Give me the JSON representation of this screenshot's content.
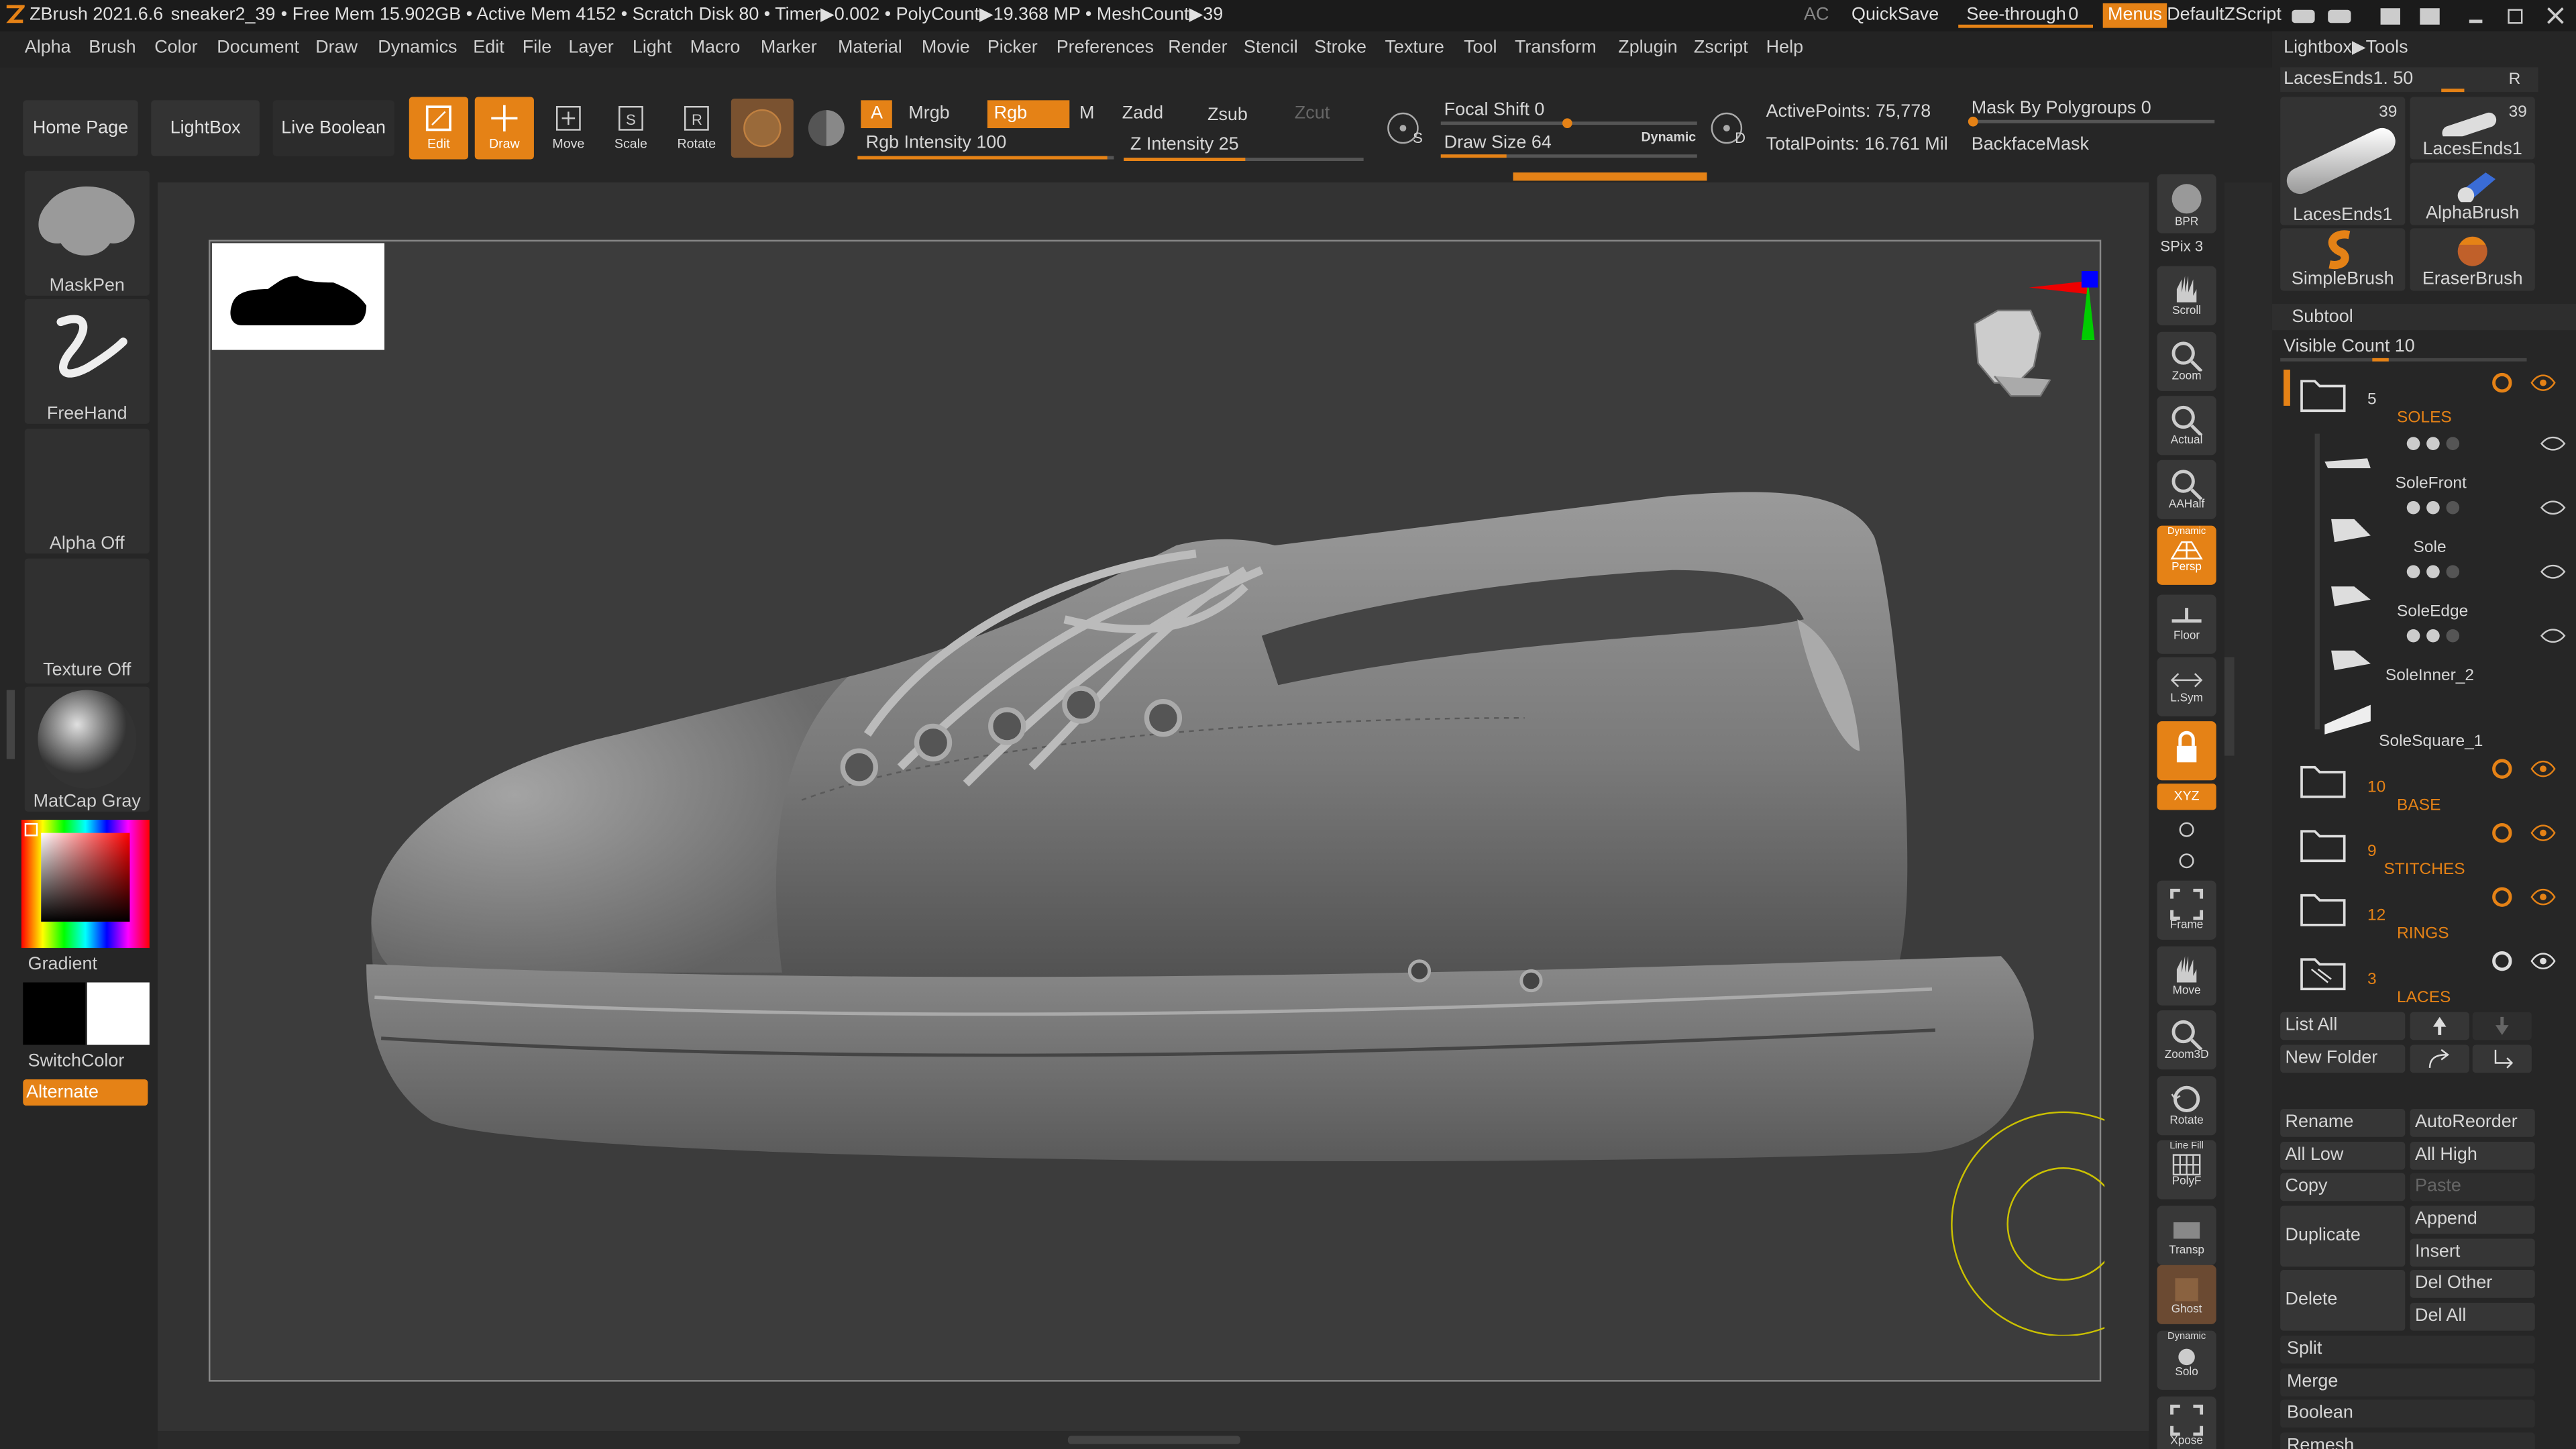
{
  "titlebar": {
    "app": "ZBrush 2021.6.6",
    "document": "sneaker2_39",
    "stats": "• Free Mem 15.902GB • Active Mem 4152 • Scratch Disk 80 • Timer▶0.002 • PolyCount▶19.368 MP • MeshCount▶39",
    "ac": "AC",
    "quicksave": "QuickSave",
    "seethrough": "See-through",
    "seethrough_val": "0",
    "menus": "Menus",
    "defaultzscript": "DefaultZScript"
  },
  "menu": [
    "Alpha",
    "Brush",
    "Color",
    "Document",
    "Draw",
    "Dynamics",
    "Edit",
    "File",
    "Layer",
    "Light",
    "Macro",
    "Marker",
    "Material",
    "Movie",
    "Picker",
    "Preferences",
    "Render",
    "Stencil",
    "Stroke",
    "Texture",
    "Tool",
    "Transform",
    "Zplugin",
    "Zscript",
    "Help"
  ],
  "toolbar": {
    "home": "Home Page",
    "lightbox": "LightBox",
    "liveboolean": "Live Boolean",
    "edit": "Edit",
    "draw": "Draw",
    "move": "Move",
    "scale": "Scale",
    "rotate": "Rotate",
    "a": "A",
    "mrgb": "Mrgb",
    "rgb": "Rgb",
    "m": "M",
    "zadd": "Zadd",
    "zsub": "Zsub",
    "zcut": "Zcut",
    "rgb_intensity": "Rgb Intensity 100",
    "z_intensity": "Z Intensity 25",
    "focal_shift": "Focal Shift 0",
    "draw_size": "Draw Size 64",
    "dynamic": "Dynamic",
    "s": "S",
    "d": "D",
    "active_points": "ActivePoints: 75,778",
    "total_points": "TotalPoints: 16.761 Mil",
    "mask_polygroups": "Mask By Polygroups 0",
    "backface": "BackfaceMask",
    "rgb_value": 100,
    "z_value": 25,
    "focal_value": 0,
    "drawsize_value": 64
  },
  "left": {
    "maskpen": "MaskPen",
    "freehand": "FreeHand",
    "alpha": "Alpha Off",
    "texture": "Texture Off",
    "matcap": "MatCap Gray",
    "gradient": "Gradient",
    "switchcolor": "SwitchColor",
    "alternate": "Alternate"
  },
  "rightshelf": [
    "BPR",
    "SPix 3",
    "Scroll",
    "Zoom",
    "Actual",
    "AAHalf",
    "Persp",
    "Floor",
    "L.Sym",
    "",
    "XYZ",
    "",
    "",
    "Frame",
    "Move",
    "Zoom3D",
    "Rotate",
    "PolyF",
    "Transp",
    "Ghost",
    "Solo",
    "Xpose"
  ],
  "rightshelf_extra": {
    "dynamic": "Dynamic",
    "linefill": "Line Fill"
  },
  "rightpanel": {
    "header": "Lightbox▶Tools",
    "laces_label": "LacesEnds1. 50",
    "r": "R",
    "tools": [
      {
        "name": "LacesEnds1",
        "count": "39"
      },
      {
        "name": "LacesEnds1",
        "count": "39"
      },
      {
        "name": "AlphaBrush",
        "count": ""
      },
      {
        "name": "SimpleBrush",
        "count": ""
      },
      {
        "name": "EraserBrush",
        "count": ""
      }
    ],
    "subtool": "Subtool",
    "visible_count": "Visible Count 10",
    "subtools": [
      {
        "name": "SOLES",
        "num": "5",
        "folder": true
      },
      {
        "name": "SoleFront",
        "folder": false
      },
      {
        "name": "Sole",
        "folder": false
      },
      {
        "name": "SoleEdge",
        "folder": false
      },
      {
        "name": "SoleInner_2",
        "folder": false
      },
      {
        "name": "SoleSquare_1",
        "folder": false
      },
      {
        "name": "BASE",
        "num": "10",
        "folder": true
      },
      {
        "name": "STITCHES",
        "num": "9",
        "folder": true
      },
      {
        "name": "RINGS",
        "num": "12",
        "folder": true
      },
      {
        "name": "LACES",
        "num": "3",
        "folder": true
      }
    ],
    "listall": "List All",
    "newfolder": "New Folder",
    "rename": "Rename",
    "autoreorder": "AutoReorder",
    "alllow": "All Low",
    "allhigh": "All High",
    "copy": "Copy",
    "paste": "Paste",
    "duplicate": "Duplicate",
    "append": "Append",
    "insert": "Insert",
    "delete": "Delete",
    "delother": "Del Other",
    "delall": "Del All",
    "split": "Split",
    "merge": "Merge",
    "boolean": "Boolean",
    "remesh": "Remesh"
  },
  "colors": {
    "accent": "#e58216",
    "bg": "#2a2a2a"
  }
}
